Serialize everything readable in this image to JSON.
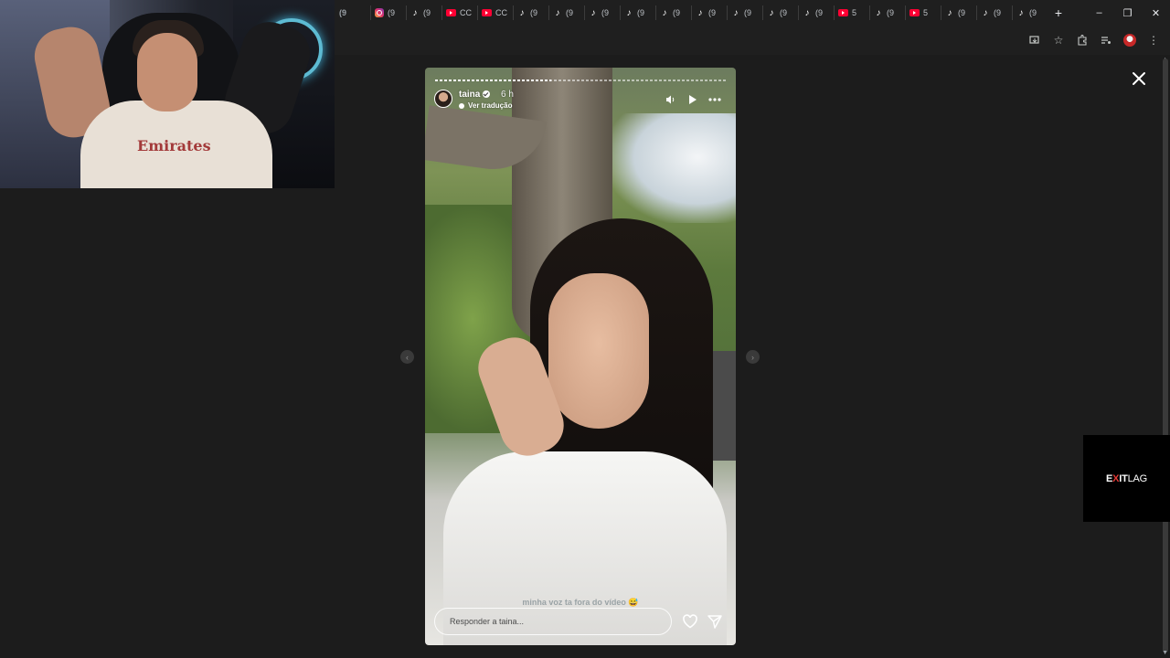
{
  "browser": {
    "tabs": [
      {
        "icon": "generic-icon",
        "glyph": "(9",
        "label": ""
      },
      {
        "icon": "instagram-icon",
        "glyph": "",
        "label": "(9"
      },
      {
        "icon": "tiktok-icon",
        "glyph": "♪",
        "label": "(9"
      },
      {
        "icon": "youtube-icon",
        "glyph": "",
        "label": "CC"
      },
      {
        "icon": "youtube-icon",
        "glyph": "",
        "label": "CC"
      },
      {
        "icon": "tiktok-icon",
        "glyph": "♪",
        "label": "(9"
      },
      {
        "icon": "tiktok-icon",
        "glyph": "♪",
        "label": "(9"
      },
      {
        "icon": "tiktok-icon",
        "glyph": "♪",
        "label": "(9"
      },
      {
        "icon": "tiktok-icon",
        "glyph": "♪",
        "label": "(9"
      },
      {
        "icon": "tiktok-icon",
        "glyph": "♪",
        "label": "(9"
      },
      {
        "icon": "tiktok-icon",
        "glyph": "♪",
        "label": "(9"
      },
      {
        "icon": "tiktok-icon",
        "glyph": "♪",
        "label": "(9"
      },
      {
        "icon": "tiktok-icon",
        "glyph": "♪",
        "label": "(9"
      },
      {
        "icon": "tiktok-icon",
        "glyph": "♪",
        "label": "(9"
      },
      {
        "icon": "youtube-icon",
        "glyph": "",
        "label": "5"
      },
      {
        "icon": "tiktok-icon",
        "glyph": "♪",
        "label": "(9"
      },
      {
        "icon": "youtube-icon",
        "glyph": "",
        "label": "5"
      },
      {
        "icon": "tiktok-icon",
        "glyph": "♪",
        "label": "(9"
      },
      {
        "icon": "tiktok-icon",
        "glyph": "♪",
        "label": "(9"
      },
      {
        "icon": "tiktok-icon",
        "glyph": "♪",
        "label": "(9"
      }
    ],
    "new_tab_glyph": "+",
    "window_controls": {
      "minimize": "–",
      "restore": "❐",
      "close": "✕"
    }
  },
  "story": {
    "username": "taina",
    "time": "6 h",
    "translate_label": "Ver tradução",
    "progress": 0.4,
    "caption": "minha voz ta fora do vídeo 😅",
    "reply_placeholder": "Responder a taina...",
    "prev_glyph": "‹",
    "next_glyph": "›"
  },
  "overlay": {
    "ad_text_part1": "E",
    "ad_text_accent": "X",
    "ad_text_part2": "IT",
    "ad_text_part3": "LAG",
    "webcam_shirt_text": "Emirates"
  },
  "colors": {
    "page_bg": "#1c1c1c",
    "chrome_bg": "#1f1f1f",
    "accent_red": "#e53935"
  }
}
